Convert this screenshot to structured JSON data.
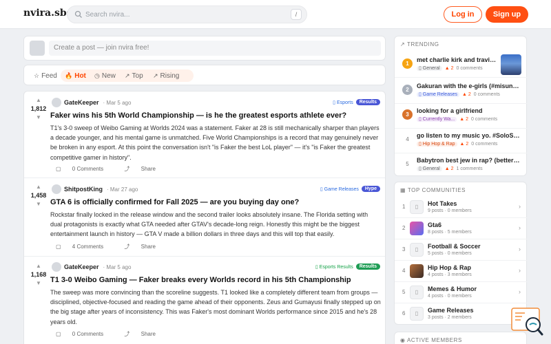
{
  "header": {
    "logo": "nvira.sbs",
    "search_placeholder": "Search nvira...",
    "search_shortcut": "/",
    "login_label": "Log in",
    "signup_label": "Sign up"
  },
  "create_post": {
    "placeholder": "Create a post — join nvira free!"
  },
  "sort_tabs": [
    {
      "label": "Feed",
      "icon": "☆"
    },
    {
      "label": "Hot",
      "icon": "🔥"
    },
    {
      "label": "New",
      "icon": "◷"
    },
    {
      "label": "Top",
      "icon": "↗"
    },
    {
      "label": "Rising",
      "icon": "↗"
    }
  ],
  "posts": [
    {
      "votes": "1,812",
      "author": "GateKeeper",
      "time": "· Mar 5 ago",
      "category": "▯ Esports",
      "flair": "Results",
      "title": "Faker wins his 5th World Championship — is he the greatest esports athlete ever?",
      "body": "T1's 3-0 sweep of Weibo Gaming at Worlds 2024 was a statement. Faker at 28 is still mechanically sharper than players a decade younger, and his mental game is unmatched. Five World Championships is a record that may genuinely never be broken in any esport. At this point the conversation isn't \"is Faker the best LoL player\" — it's \"is Faker the greatest competitive gamer in history\".",
      "comments": "0 Comments",
      "share": "Share"
    },
    {
      "votes": "1,458",
      "author": "ShitpostKing",
      "time": "· Mar 27 ago",
      "category": "▯ Game Releases",
      "flair": "Hype",
      "title": "GTA 6 is officially confirmed for Fall 2025 — are you buying day one?",
      "body": "Rockstar finally locked in the release window and the second trailer looks absolutely insane. The Florida setting with dual protagonists is exactly what GTA needed after GTAV's decade-long reign. Honestly this might be the biggest entertainment launch in history — GTA V made a billion dollars in three days and this will top that easily.",
      "comments": "4 Comments",
      "share": "Share"
    },
    {
      "votes": "1,168",
      "author": "GateKeeper",
      "time": "· Mar 5 ago",
      "category": "▯ Esports Results",
      "flair": "Results",
      "title": "T1 3-0 Weibo Gaming — Faker breaks every Worlds record in his 5th Championship",
      "body": "The sweep was more convincing than the scoreline suggests. T1 looked like a completely different team from groups — disciplined, objective-focused and reading the game ahead of their opponents. Zeus and Gumayusi finally stepped up on the big stage after years of inconsistency. This was Faker's most dominant Worlds performance since 2015 and he's 28 years old.",
      "comments": "0 Comments",
      "share": "Share"
    }
  ],
  "trending": {
    "heading": "Trending",
    "items": [
      {
        "rank": "1",
        "title": "met charlie kirk and travis ...",
        "category": "▯ General",
        "score": "2",
        "comments": "0 comments"
      },
      {
        "rank": "2",
        "title": "Gakuran with the e-girls (#misunderstanding...",
        "category": "▯ Game Releases",
        "score": "2",
        "comments": "0 comments"
      },
      {
        "rank": "3",
        "title": "looking for a girlfriend",
        "category": "▯ Currently Wa...",
        "score": "2",
        "comments": "0 comments"
      },
      {
        "rank": "4",
        "title": "go listen to my music yo. #SoloSlick",
        "category": "▯ Hip Hop & Rap",
        "score": "2",
        "comments": "0 comments"
      },
      {
        "rank": "5",
        "title": "Babytron best jew in rap? (better than...",
        "category": "▯ General",
        "score": "2",
        "comments": "1 comments"
      }
    ]
  },
  "communities": {
    "heading": "Top Communities",
    "items": [
      {
        "rank": "1",
        "name": "Hot Takes",
        "stats": "9 posts · 0 members"
      },
      {
        "rank": "2",
        "name": "Gta6",
        "stats": "8 posts · 5 members"
      },
      {
        "rank": "3",
        "name": "Football & Soccer",
        "stats": "5 posts · 0 members"
      },
      {
        "rank": "4",
        "name": "Hip Hop & Rap",
        "stats": "4 posts · 3 members"
      },
      {
        "rank": "5",
        "name": "Memes & Humor",
        "stats": "4 posts · 0 members"
      },
      {
        "rank": "6",
        "name": "Game Releases",
        "stats": "3 posts · 2 members"
      }
    ]
  },
  "active_members": {
    "heading": "Active Members"
  }
}
